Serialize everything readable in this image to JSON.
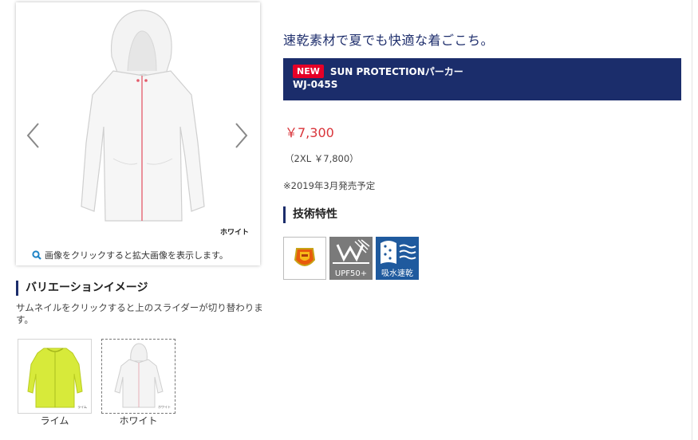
{
  "gallery": {
    "color_caption": "ホワイト",
    "zoom_hint": "画像をクリックすると拡大画像を表示します。"
  },
  "variations": {
    "heading": "バリエーションイメージ",
    "description": "サムネイルをクリックすると上のスライダーが切り替わります。",
    "items": [
      {
        "label": "ライム",
        "tag": "ライム",
        "color": "#d7ea3a"
      },
      {
        "label": "ホワイト",
        "tag": "ホワイト",
        "color": "#f2f2f2"
      }
    ]
  },
  "product": {
    "tagline": "速乾素材で夏でも快適な着ごこち。",
    "badge": "NEW",
    "name": "SUN PROTECTIONパーカー",
    "code": "WJ-045S",
    "price": "￥7,300",
    "price_2xl": "（2XL ￥7,800）",
    "release_note": "※2019年3月発売予定"
  },
  "tech": {
    "heading": "技術特性",
    "icons": [
      {
        "name": "shield-emblem",
        "caption": ""
      },
      {
        "name": "upf-icon",
        "caption": "UPF50+"
      },
      {
        "name": "quick-dry-icon",
        "caption": "吸水速乾"
      }
    ]
  },
  "colors": {
    "brand_navy": "#1b2d6b",
    "new_red": "#e60027",
    "price_red": "#d9343a",
    "upf_gray": "#7a7a7a",
    "quickdry_blue": "#1f5a9e"
  }
}
